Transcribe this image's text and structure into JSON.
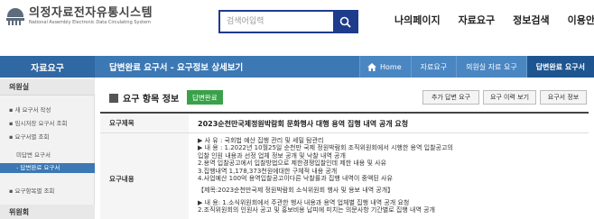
{
  "header": {
    "logo_title": "의정자료전자유통시스템",
    "logo_subtitle": "National Assembly Electronic Data Circulating System",
    "search_placeholder": "검색어입력",
    "gnb": [
      "나의페이지",
      "자료요구",
      "정보검색",
      "이용안내"
    ]
  },
  "nav": {
    "side_title": "자료요구",
    "page_heading": "답변완료 요구서 - 요구정보 상세보기",
    "breadcrumbs": [
      "Home",
      "자료요구",
      "의원실 자료 요구",
      "답변완료 요구서"
    ]
  },
  "sidebar": {
    "section1": "의원실",
    "items": [
      "새 요구서 작성",
      "임시저장 요구서 조회",
      "요구서별 조회"
    ],
    "subitems": [
      "미답변 요구서",
      "답변완료 요구서"
    ],
    "item_after": "요구항목별 조회",
    "section2": "위원회"
  },
  "main": {
    "section_title": "요구 항목 정보",
    "status_badge": "답변완료",
    "buttons": [
      "추가 답변 요구",
      "요구 이력 보기",
      "요구서 정보"
    ],
    "rows": {
      "title_label": "요구제목",
      "title_value": "2023순천만국제정원박람회 문화행사 대행 용역 집행 내역 공개 요청",
      "content_label": "요구내용",
      "content_lines": [
        "▶ 사 유 : 국회법 예산 집행 관리 및 세밀 탐관리",
        "▶ 내 용 : 1.2022년 10월25일 순천만 국제 정원박람회 조직위원회에서 시행한 용역 입찰공고의",
        "입찰 인원 내용과 선정 업체 정보 공개 및 낙찰 내역 공개",
        "2.용역 입찰공고에서 입찰방법으로 제한경쟁입찰인데 제한 내용 및 사유",
        "3.집행내역 1,178,373천원에대한 구체적 내용 공개",
        "4.사업예산 100억 용역입찰공고이다른 낙찰률과 집행 내역이 중액된 사유",
        "",
        "【제목:2023순천만국제 정원박람회 소식위원회 행사 및 용보 내역 공개】",
        "",
        "▶ 내 용: 1.소식위원회에서 주관한 행사 내용과 용역 업체별 집행 내역 공개 요청",
        "2.조직위원회의 인원사 공고 및 홍보비용 납피에 미치는 의문사항 기간별로 집행 내역 공개"
      ]
    }
  },
  "colors": {
    "navy": "#1f3b8c",
    "nav_blue": "#3c78b4",
    "badge_green": "#3aa14a"
  }
}
